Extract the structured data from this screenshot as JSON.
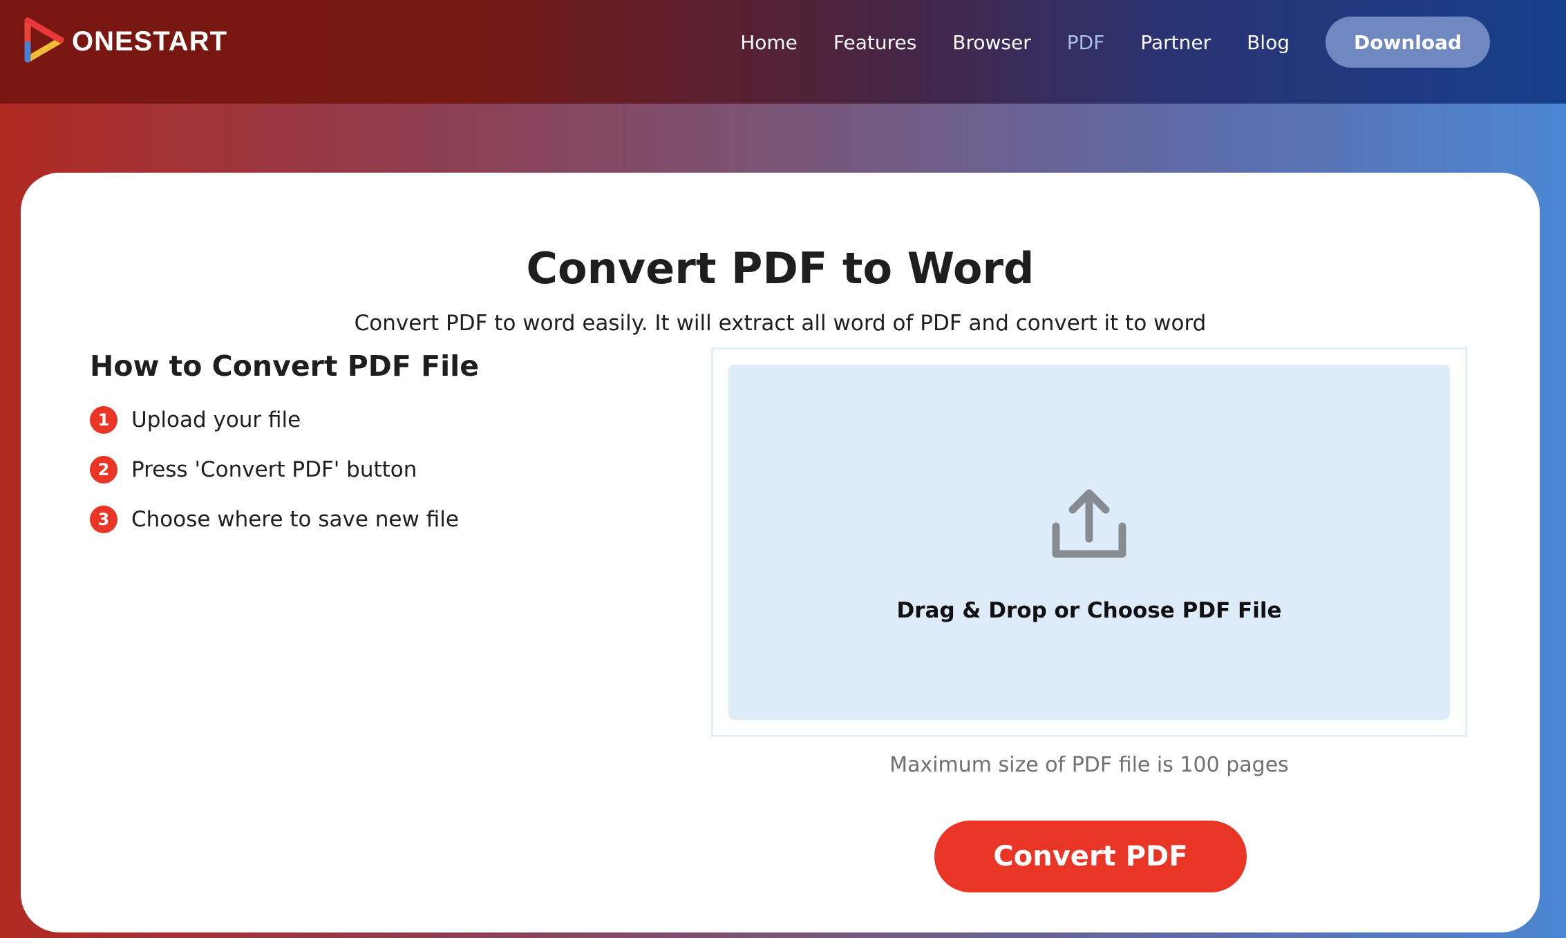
{
  "header": {
    "brand": "ONESTART",
    "nav": [
      {
        "label": "Home",
        "active": false
      },
      {
        "label": "Features",
        "active": false
      },
      {
        "label": "Browser",
        "active": false
      },
      {
        "label": "PDF",
        "active": true
      },
      {
        "label": "Partner",
        "active": false
      },
      {
        "label": "Blog",
        "active": false
      }
    ],
    "download_label": "Download"
  },
  "main": {
    "title": "Convert PDF to Word",
    "subtitle": "Convert PDF to word easily. It will extract all word of PDF and convert it to word",
    "steps_title": "How to Convert PDF File",
    "steps": [
      {
        "num": "1",
        "text": "Upload your file"
      },
      {
        "num": "2",
        "text": "Press 'Convert PDF' button"
      },
      {
        "num": "3",
        "text": "Choose where to save new file"
      }
    ],
    "upload": {
      "icon": "upload-icon",
      "label": "Drag & Drop or Choose PDF File"
    },
    "max_note": "Maximum size of PDF file is 100 pages",
    "convert_label": "Convert PDF"
  },
  "colors": {
    "accent_red": "#e83525",
    "download_btn": "#7088c0",
    "drop_zone": "#deebf8",
    "icon_gray": "#858b91"
  }
}
